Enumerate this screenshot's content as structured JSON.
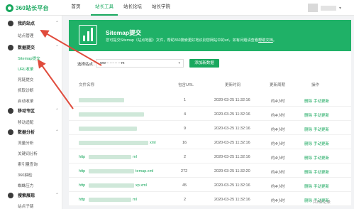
{
  "header": {
    "logo_text": "360站长平台",
    "nav": [
      "首页",
      "站长工具",
      "站长论坛",
      "站长学院"
    ],
    "active_nav_index": 1
  },
  "sidebar": {
    "groups": [
      {
        "label": "我的站点",
        "items": [
          "站点管理"
        ]
      },
      {
        "label": "数据提交",
        "items": [
          "Sitemap提交",
          "URL收录",
          "死链提交",
          "抓取诊断",
          "启动收录"
        ]
      },
      {
        "label": "移动专区",
        "items": [
          "移动适配"
        ]
      },
      {
        "label": "数据分析",
        "items": [
          "流量分析",
          "关键词分析",
          "索引量查询",
          "360抽检",
          "蜘蛛压力"
        ]
      },
      {
        "label": "搜索展现",
        "items": [
          "站点子链"
        ]
      }
    ],
    "active_item": "Sitemap提交"
  },
  "banner": {
    "title": "Sitemap提交",
    "desc_prefix": "您可提交Sitemap（站点地图）文件，帮助360搜索更好地识别您网站中的url，如有问题请查看",
    "desc_link": "帮助文档",
    "desc_suffix": "。"
  },
  "form": {
    "select_label": "选择站点：",
    "select_value": "ww············m",
    "add_button": "添加新数据"
  },
  "table": {
    "headers": [
      "文件名称",
      "包含URL",
      "更新时间",
      "更新周期",
      "操作"
    ],
    "rows": [
      {
        "url_prefix": "",
        "url_suffix": "",
        "count": "1",
        "time": "2020-03-25 11:32:16",
        "period": "约4小时"
      },
      {
        "url_prefix": "",
        "url_suffix": "",
        "count": "4",
        "time": "2020-03-25 11:32:16",
        "period": "约4小时"
      },
      {
        "url_prefix": "",
        "url_suffix": "",
        "count": "9",
        "time": "2020-03-25 11:32:16",
        "period": "约4小时"
      },
      {
        "url_prefix": "",
        "url_suffix": "xml",
        "count": "16",
        "time": "2020-03-25 11:32:16",
        "period": "约4小时"
      },
      {
        "url_prefix": "http",
        "url_suffix": "ml",
        "count": "2",
        "time": "2020-03-25 11:32:16",
        "period": "约4小时"
      },
      {
        "url_prefix": "http",
        "url_suffix": "temap.xml",
        "count": "272",
        "time": "2020-03-25 11:32:20",
        "period": "约4小时"
      },
      {
        "url_prefix": "http",
        "url_suffix": "xp.xml",
        "count": "45",
        "time": "2020-03-25 11:32:16",
        "period": "约4小时"
      },
      {
        "url_prefix": "http",
        "url_suffix": "ml",
        "count": "2",
        "time": "2020-03-25 11:32:16",
        "period": "约4小时"
      }
    ],
    "action_delete": "删除",
    "action_submit": "手动更新"
  },
  "footer": {
    "text": "共8条记录"
  },
  "colors": {
    "brand": "#19a85e",
    "banner": "#1fb167",
    "arrow": "#e04b3c"
  }
}
